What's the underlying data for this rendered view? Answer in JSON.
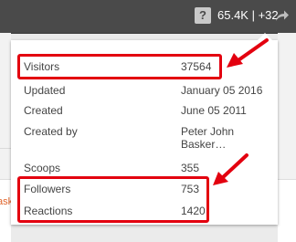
{
  "header": {
    "help_glyph": "?",
    "stats_text": "65.4K | +32"
  },
  "background": {
    "peek_text": "ask"
  },
  "popup": {
    "rows": [
      {
        "label": "Visitors",
        "value": "37564"
      },
      {
        "label": "Updated",
        "value": "January 05 2016"
      },
      {
        "label": "Created",
        "value": "June 05 2011"
      },
      {
        "label": "Created by",
        "value": "Peter John Basker…"
      },
      {
        "label": "Scoops",
        "value": "355"
      },
      {
        "label": "Followers",
        "value": "753"
      },
      {
        "label": "Reactions",
        "value": "1420"
      }
    ]
  },
  "colors": {
    "topbar": "#4a4a4a",
    "highlight": "#e3000f",
    "accent_link": "#e0652c"
  },
  "icons": [
    "help-icon",
    "share-icon",
    "red-arrow-annotation"
  ]
}
